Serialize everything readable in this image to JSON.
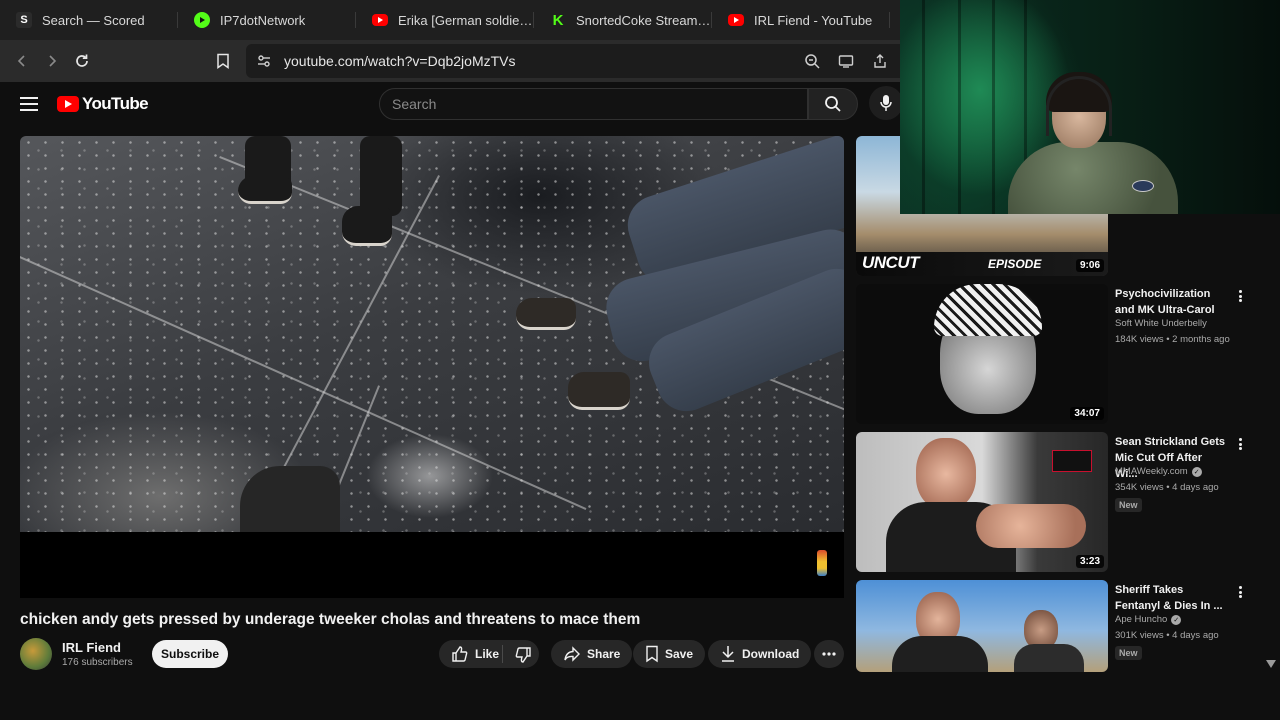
{
  "browser": {
    "tabs": [
      {
        "label": "Search — Scored",
        "icon": "scored-icon",
        "icon_text": "S",
        "color": "#2b2b2b"
      },
      {
        "label": "IP7dotNetwork",
        "icon": "kick-play-icon",
        "icon_text": "",
        "color": "#53fc18"
      },
      {
        "label": "Erika [German soldier lo",
        "icon": "youtube-icon",
        "icon_text": "",
        "color": "#ff0000"
      },
      {
        "label": "SnortedCoke Stream - W",
        "icon": "kick-icon",
        "icon_text": "K",
        "color": "#53fc18"
      },
      {
        "label": "IRL Fiend - YouTube",
        "icon": "youtube-icon",
        "icon_text": "",
        "color": "#ff0000"
      }
    ],
    "url": "youtube.com/watch?v=Dqb2joMzTVs"
  },
  "youtube": {
    "logo_text": "YouTube",
    "search_placeholder": "Search"
  },
  "video": {
    "title": "chicken andy gets pressed by underage tweeker cholas and threatens to mace them",
    "channel": "IRL Fiend",
    "subscribers": "176 subscribers",
    "subscribe_label": "Subscribe",
    "like_label": "Like",
    "share_label": "Share",
    "save_label": "Save",
    "download_label": "Download"
  },
  "recommendations": [
    {
      "title": "",
      "channel": "",
      "meta": "",
      "duration": "9:06",
      "thumb_text": "UNCUT",
      "thumb_text_2": "EPISODE",
      "verified": false,
      "new": false
    },
    {
      "title": "Psychocivilization and MK Ultra-Carol",
      "channel": "Soft White Underbelly",
      "meta": "184K views • 2 months ago",
      "duration": "34:07",
      "verified": false,
      "new": false
    },
    {
      "title": "Sean Strickland Gets Mic Cut Off After Wi...",
      "channel": "MMAWeekly.com",
      "meta": "354K views • 4 days ago",
      "duration": "3:23",
      "verified": true,
      "new": true,
      "new_label": "New"
    },
    {
      "title": "Sheriff Takes Fentanyl & Dies In ...",
      "channel": "Ape Huncho",
      "meta": "301K views • 4 days ago",
      "duration": "",
      "verified": true,
      "new": true,
      "new_label": "New"
    }
  ],
  "colors": {
    "accent": "#ff0000",
    "background": "#0f0f0f",
    "pill": "#272727"
  }
}
